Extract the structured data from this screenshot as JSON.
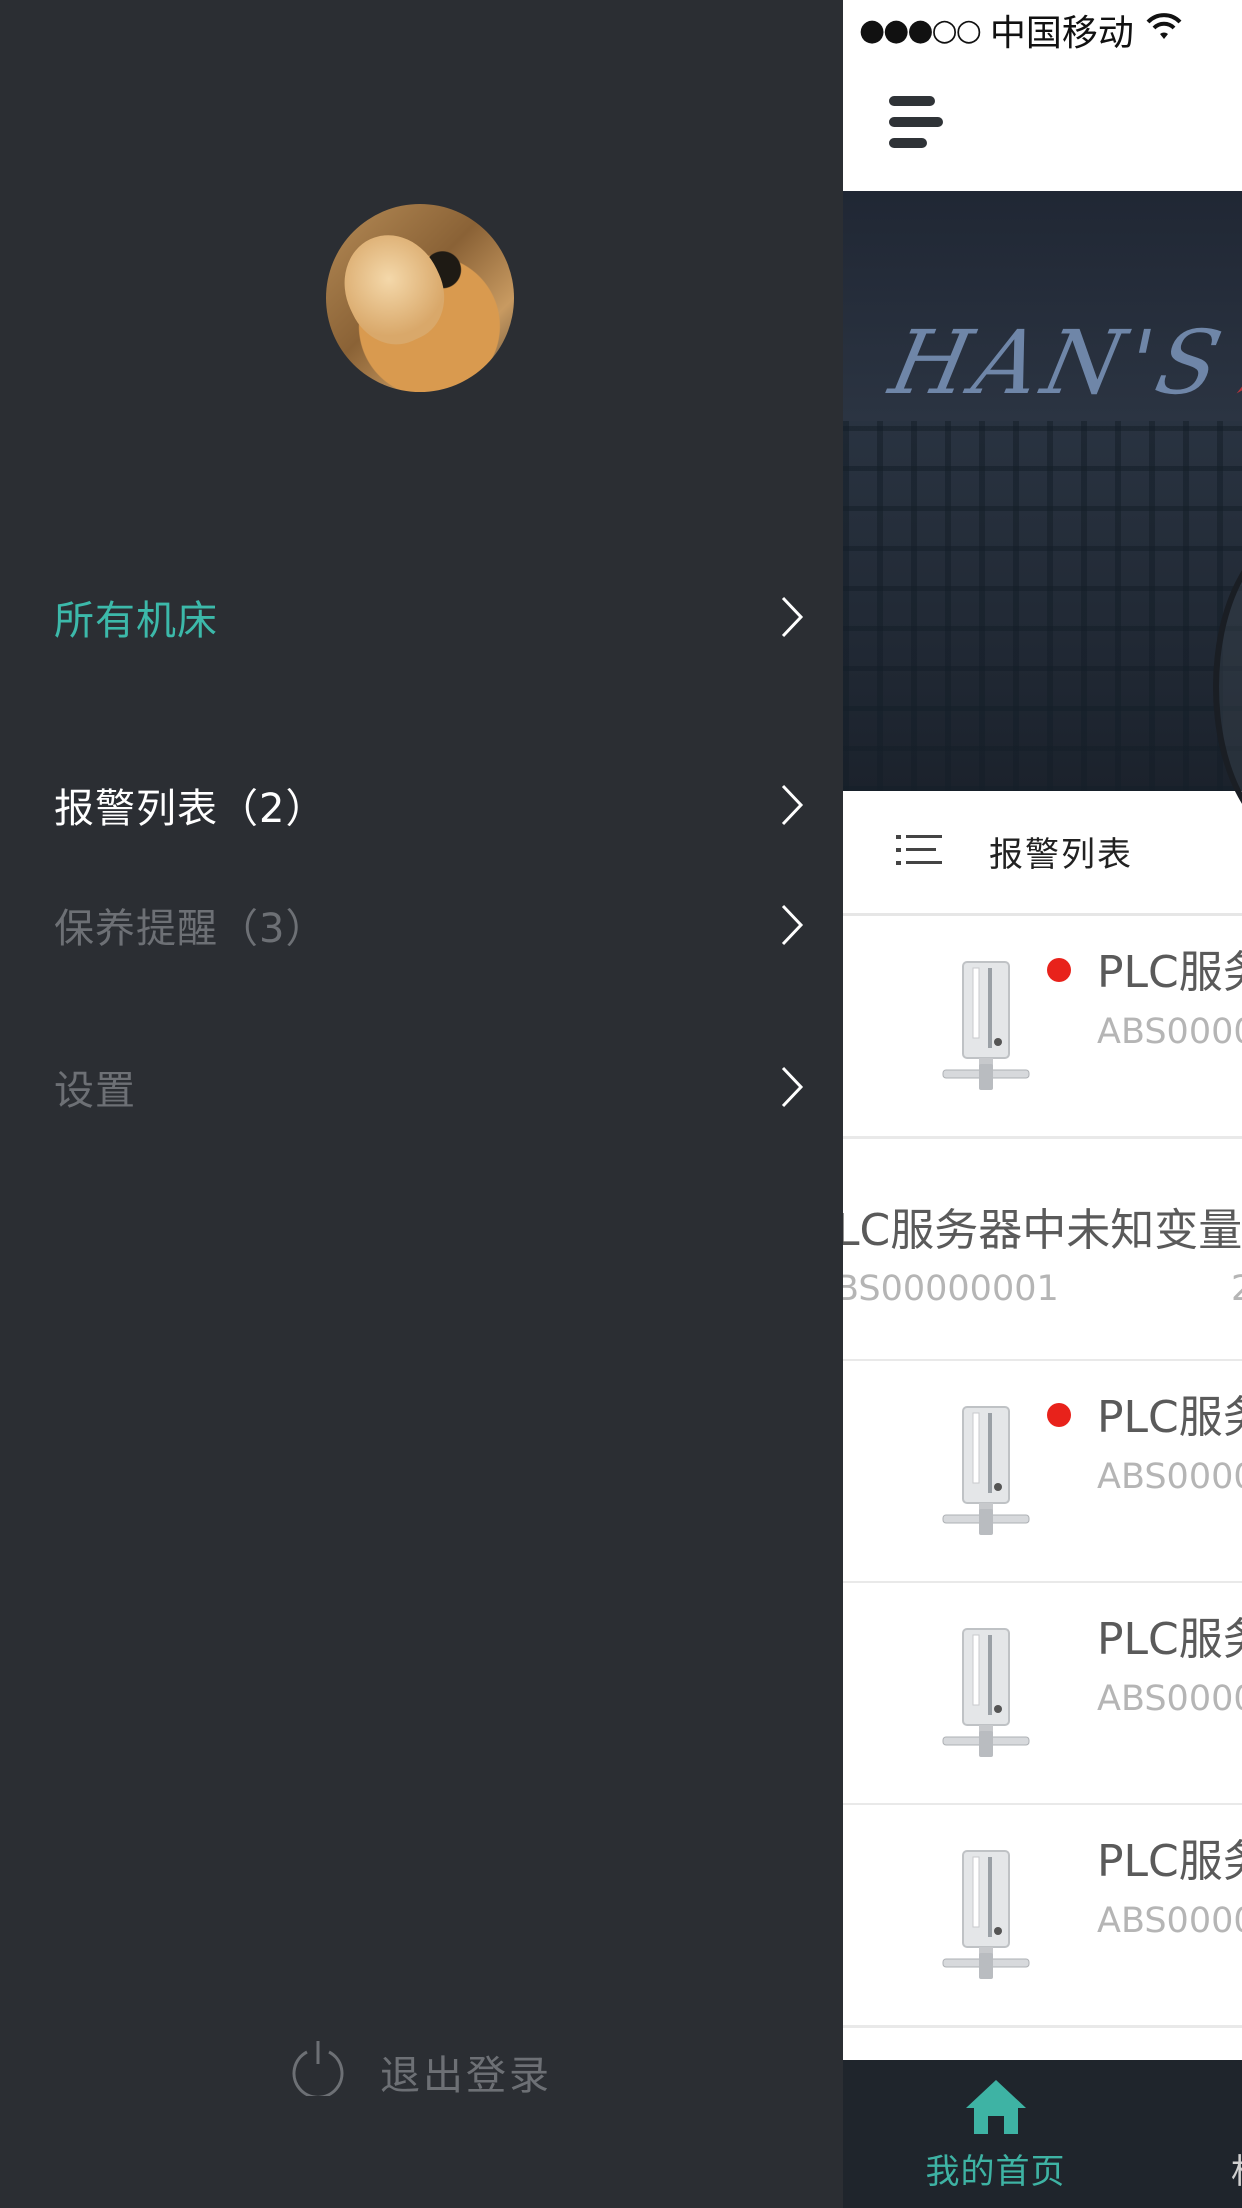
{
  "status_bar": {
    "signal_dots": "●●●○○",
    "carrier": "中国移动",
    "wifi_icon": "wifi-icon"
  },
  "drawer": {
    "menu": [
      {
        "label": "所有机床",
        "color": "#3cb9aa",
        "active": true
      },
      {
        "label": "报警列表（2）",
        "color": "#ffffff",
        "active": false
      },
      {
        "label": "保养提醒（3）",
        "color": "#6d7075",
        "active": false
      },
      {
        "label": "设置",
        "color": "#6d7075",
        "active": false
      }
    ],
    "logout_label": "退出登录"
  },
  "main": {
    "banner_sign": "HAN'S",
    "section_title": "报警列表",
    "rows": [
      {
        "name": "PLC服务",
        "code": "ABS0000",
        "alarm": true
      },
      {
        "name": "LC服务器中未知变量",
        "code": "BS00000001",
        "extra": "2",
        "alarm": false
      },
      {
        "name": "PLC服务",
        "code": "ABS0000",
        "alarm": true
      },
      {
        "name": "PLC服务",
        "code": "ABS0000",
        "alarm": false
      },
      {
        "name": "PLC服务",
        "code": "ABS0000",
        "alarm": false
      }
    ],
    "tabbar": {
      "home_label": "我的首页",
      "next_label": "机"
    }
  },
  "colors": {
    "drawer_bg": "#2b2e33",
    "accent": "#3cb9aa",
    "alarm_dot": "#e8221b",
    "tabbar_bg": "#1f252c"
  }
}
